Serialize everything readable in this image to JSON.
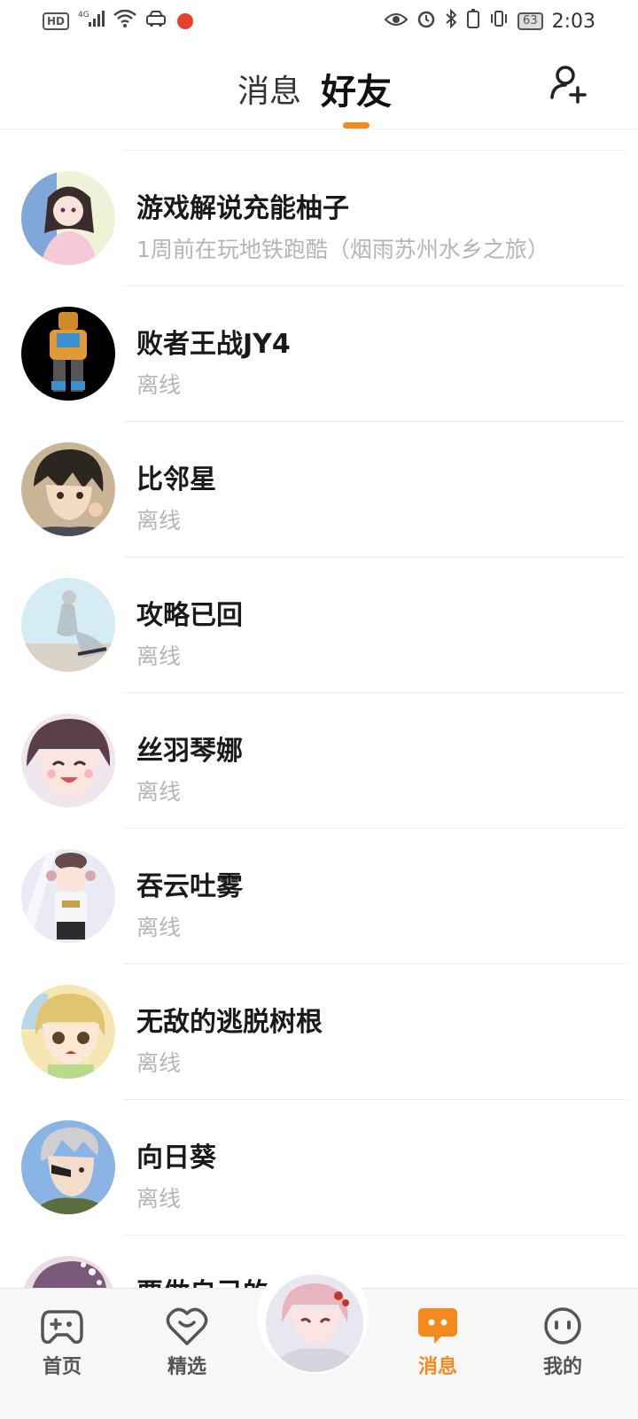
{
  "status_bar": {
    "hd_label": "HD",
    "network_label": "4G",
    "battery_level": "63",
    "time": "2:03"
  },
  "header": {
    "tab_messages": "消息",
    "tab_friends": "好友",
    "active_tab": "好友",
    "accent_color": "#f28a1e"
  },
  "friends": [
    {
      "name": "游戏解说充能柚子",
      "status": "1周前在玩地铁跑酷（烟雨苏州水乡之旅）",
      "avatar": "anime-girl-pink-hoodie-avatar"
    },
    {
      "name": "败者王战JY4",
      "status": "离线",
      "avatar": "armored-robot-avatar"
    },
    {
      "name": "比邻星",
      "status": "离线",
      "avatar": "anime-boy-avatar"
    },
    {
      "name": "攻略已回",
      "status": "离线",
      "avatar": "figure-light-blue-avatar"
    },
    {
      "name": "丝羽琴娜",
      "status": "离线",
      "avatar": "anime-girl-smiling-avatar"
    },
    {
      "name": "吞云吐雾",
      "status": "离线",
      "avatar": "anime-girl-hat-avatar"
    },
    {
      "name": "无敌的逃脱树根",
      "status": "离线",
      "avatar": "anime-girl-blonde-avatar"
    },
    {
      "name": "向日葵",
      "status": "离线",
      "avatar": "anime-boy-gray-hair-avatar"
    },
    {
      "name": "要做自己的",
      "status": "",
      "avatar": "anime-girl-dotted-hat-avatar"
    }
  ],
  "bottom_nav": {
    "items": [
      {
        "label": "首页",
        "icon": "gamepad-icon"
      },
      {
        "label": "精选",
        "icon": "heart-chat-icon"
      },
      {
        "label": "消息",
        "icon": "chat-bubble-icon",
        "active": true
      },
      {
        "label": "我的",
        "icon": "smiley-face-icon"
      }
    ],
    "center_avatar": "anime-character-avatar"
  }
}
